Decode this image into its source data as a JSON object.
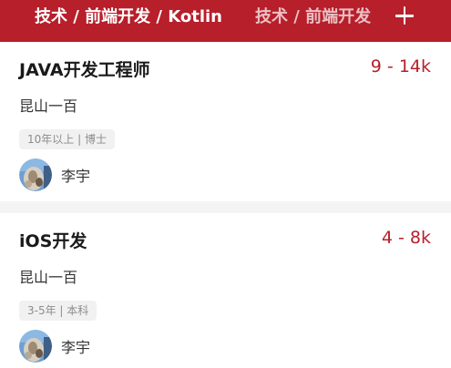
{
  "header": {
    "active_tab": "技术 / 前端开发 / Kotlin",
    "inactive_tab": "技术 / 前端开发",
    "add_icon": "plus-icon",
    "bg_color": "#b71f2b"
  },
  "jobs": [
    {
      "title": "JAVA开发工程师",
      "salary": "9 - 14k",
      "company": "昆山一百",
      "tag": "10年以上 | 博士",
      "recruiter": "李宇",
      "avatar_icon": "recruiter-avatar"
    },
    {
      "title": "iOS开发",
      "salary": "4 - 8k",
      "company": "昆山一百",
      "tag": "3-5年 | 本科",
      "recruiter": "李宇",
      "avatar_icon": "recruiter-avatar"
    }
  ],
  "colors": {
    "accent": "#b71f2b",
    "page_bg": "#f4f4f4",
    "tag_bg": "#f1f1f1",
    "tag_text": "#8d8d8d"
  }
}
